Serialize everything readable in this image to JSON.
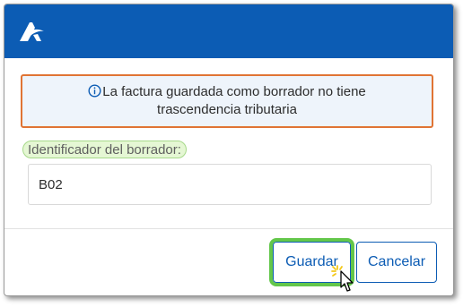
{
  "header": {
    "logo_icon": "agencia-tributaria-logo-icon",
    "background_color": "#0c5cb4"
  },
  "alert": {
    "icon": "info-icon",
    "text": "La factura guardada como borrador no tiene trascendencia tributaria",
    "border_color": "#e07434"
  },
  "draft_id": {
    "label": "Identificador del borrador:",
    "value": "B02"
  },
  "footer": {
    "save_label": "Guardar",
    "cancel_label": "Cancelar",
    "highlight_color": "#63c74a"
  },
  "cursor": {
    "icon": "pointer-cursor-click-icon"
  }
}
